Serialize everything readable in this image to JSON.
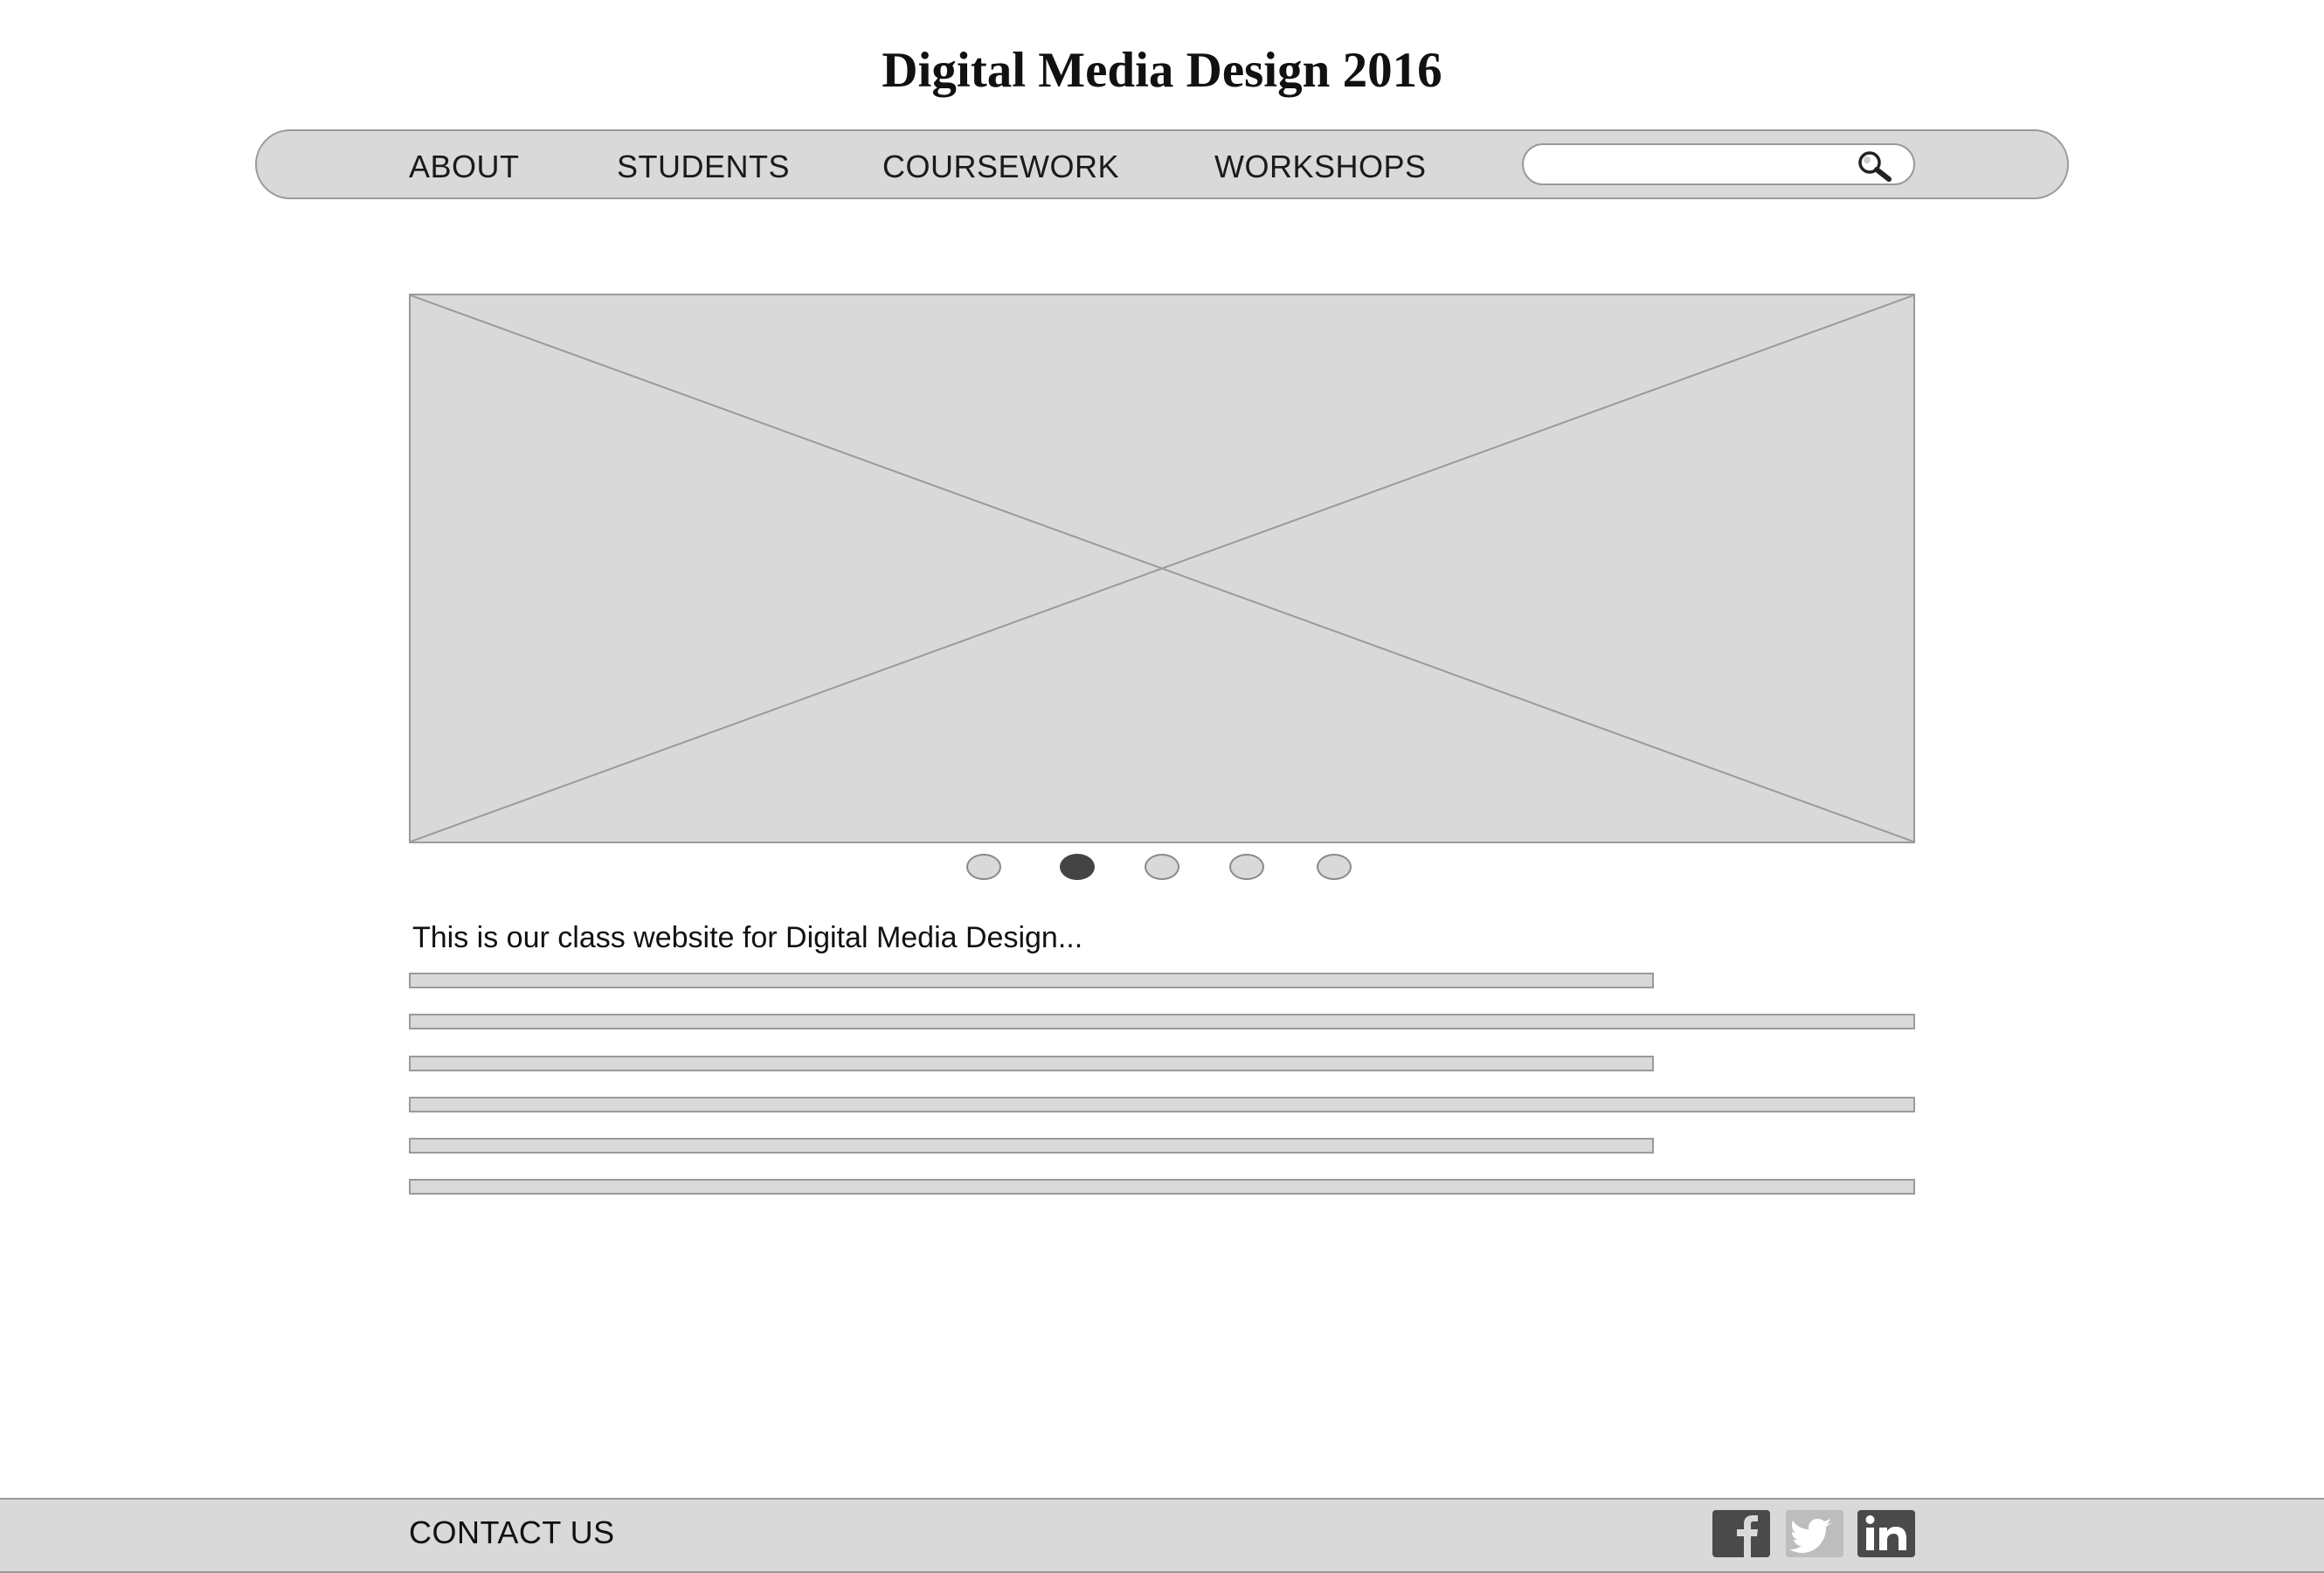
{
  "header": {
    "title": "Digital Media Design 2016"
  },
  "nav": {
    "items": [
      {
        "label": "ABOUT"
      },
      {
        "label": "STUDENTS"
      },
      {
        "label": "COURSEWORK"
      },
      {
        "label": "WORKSHOPS"
      }
    ],
    "search": {
      "value": "",
      "placeholder": "",
      "icon": "search-icon"
    }
  },
  "carousel": {
    "slide_count": 5,
    "active_index": 1,
    "image_icon": "image-placeholder-icon"
  },
  "content": {
    "intro": "This is our class website for Digital Media Design..."
  },
  "footer": {
    "contact_label": "CONTACT US",
    "social": [
      {
        "icon": "facebook-icon"
      },
      {
        "icon": "twitter-icon"
      },
      {
        "icon": "linkedin-icon"
      }
    ]
  },
  "colors": {
    "wire_fill": "#d9d9d9",
    "wire_stroke": "#9a9a9a",
    "active_dot": "#444444",
    "social_dark": "#4a4a4a",
    "social_light": "#bdbdbd"
  }
}
